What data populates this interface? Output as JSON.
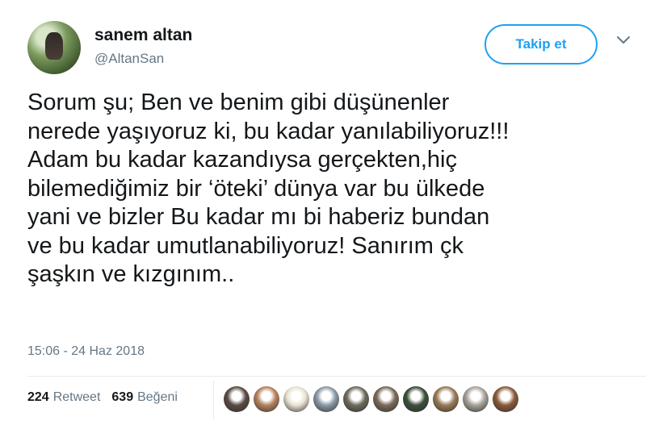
{
  "profile": {
    "display_name": "sanem altan",
    "handle": "@AltanSan",
    "follow_label": "Takip et"
  },
  "tweet": {
    "text_lines": [
      "Sorum şu; Ben ve benim gibi düşünenler",
      "nerede yaşıyoruz ki, bu kadar yanılabiliyoruz!!!",
      "Adam bu kadar kazandıysa gerçekten,hiç",
      "bilemediğimiz bir ‘öteki’ dünya var bu ülkede",
      "yani ve bizler Bu kadar mı bi haberiz bundan",
      "ve bu kadar umutlanabiliyoruz! Sanırım çk",
      "şaşkın ve kızgınım.."
    ],
    "timestamp": "15:06 - 24 Haz 2018"
  },
  "stats": {
    "retweet_count": "224",
    "retweet_label": "Retweet",
    "like_count": "639",
    "like_label": "Beğeni"
  },
  "likers": [
    {
      "icon": "avatar",
      "color": "#5b4a45"
    },
    {
      "icon": "avatar",
      "color": "#b5835f"
    },
    {
      "icon": "avatar",
      "color": "#e9e2d2"
    },
    {
      "icon": "avatar",
      "color": "#8b9aa6"
    },
    {
      "icon": "avatar",
      "color": "#6d6b5c"
    },
    {
      "icon": "avatar",
      "color": "#7b6a58"
    },
    {
      "icon": "avatar",
      "color": "#3c4f3a"
    },
    {
      "icon": "avatar",
      "color": "#9a7a56"
    },
    {
      "icon": "avatar",
      "color": "#a7a29a"
    },
    {
      "icon": "avatar",
      "color": "#8a5a3a"
    }
  ],
  "colors": {
    "accent": "#1da1f2",
    "secondary_text": "#657786",
    "divider": "#e6ecf0"
  }
}
